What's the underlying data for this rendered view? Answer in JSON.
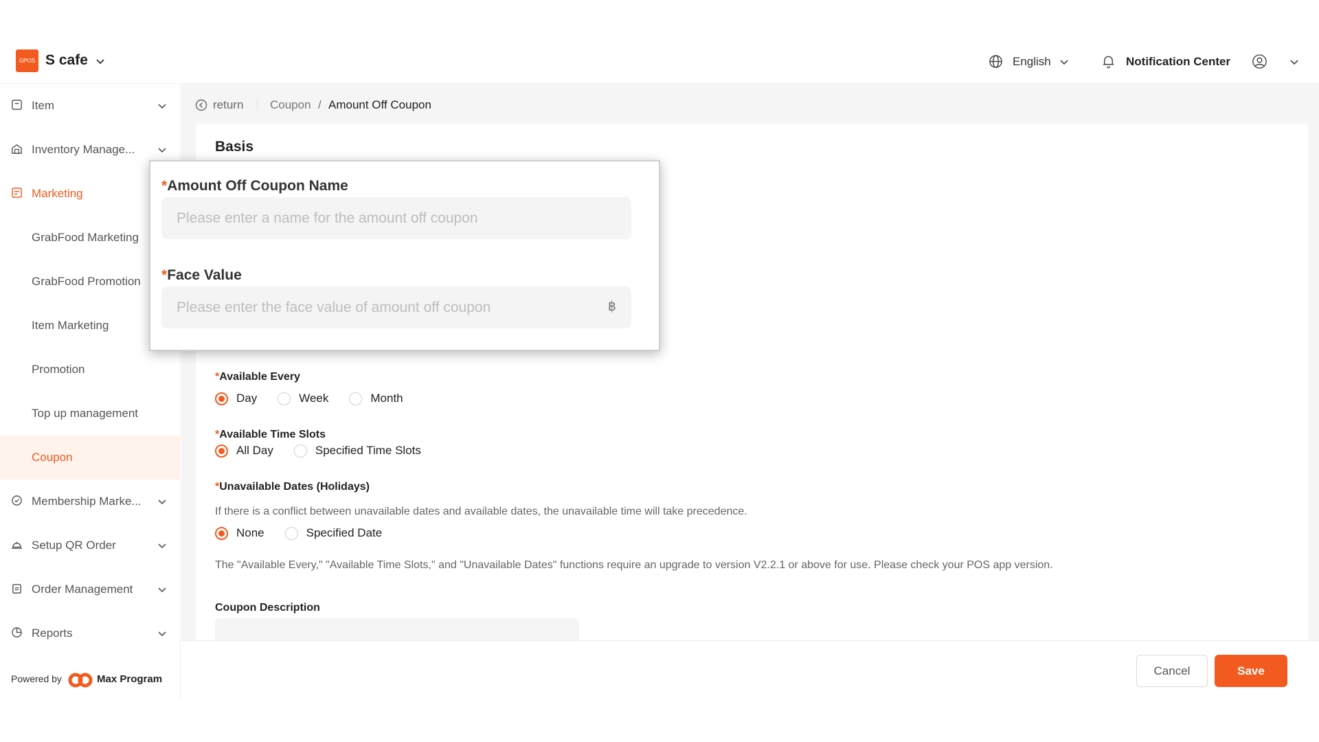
{
  "header": {
    "logo_text": "GPOS",
    "store_name": "S cafe",
    "language": "English",
    "notification": "Notification Center"
  },
  "sidebar": {
    "items": [
      {
        "label": "Item"
      },
      {
        "label": "Inventory Manage..."
      },
      {
        "label": "Marketing"
      },
      {
        "label": "GrabFood Marketing"
      },
      {
        "label": "GrabFood Promotion"
      },
      {
        "label": "Item Marketing"
      },
      {
        "label": "Promotion"
      },
      {
        "label": "Top up management"
      },
      {
        "label": "Coupon"
      },
      {
        "label": "Membership Marke..."
      },
      {
        "label": "Setup QR Order"
      },
      {
        "label": "Order Management"
      },
      {
        "label": "Reports"
      }
    ],
    "powered_by": "Powered by",
    "powered_brand": "Max Program"
  },
  "breadcrumb": {
    "return": "return",
    "parent": "Coupon",
    "separator": "/",
    "current": "Amount Off Coupon"
  },
  "form": {
    "section_title": "Basis",
    "required_mark": "*",
    "coupon_name_label": "Amount Off Coupon Name",
    "coupon_name_placeholder": "Please enter a name for the amount off coupon",
    "face_value_label": "Face Value",
    "face_value_placeholder": "Please enter the face value of amount off coupon",
    "currency_suffix": "฿",
    "available_every_label": "Available Every",
    "available_every_options": [
      "Day",
      "Week",
      "Month"
    ],
    "time_slots_label": "Available Time Slots",
    "time_slots_options": [
      "All Day",
      "Specified Time Slots"
    ],
    "unavailable_label": "Unavailable Dates (Holidays)",
    "unavailable_hint": "If there is a conflict between unavailable dates and available dates, the unavailable time will take precedence.",
    "unavailable_options": [
      "None",
      "Specified Date"
    ],
    "version_note": "The \"Available Every,\" \"Available Time Slots,\" and \"Unavailable Dates\" functions require an upgrade to version V2.2.1 or above for use. Please check your POS app version.",
    "description_label": "Coupon Description"
  },
  "footer": {
    "cancel": "Cancel",
    "save": "Save"
  },
  "colors": {
    "accent": "#f25a1f",
    "selected_bg": "#fff3ec"
  }
}
